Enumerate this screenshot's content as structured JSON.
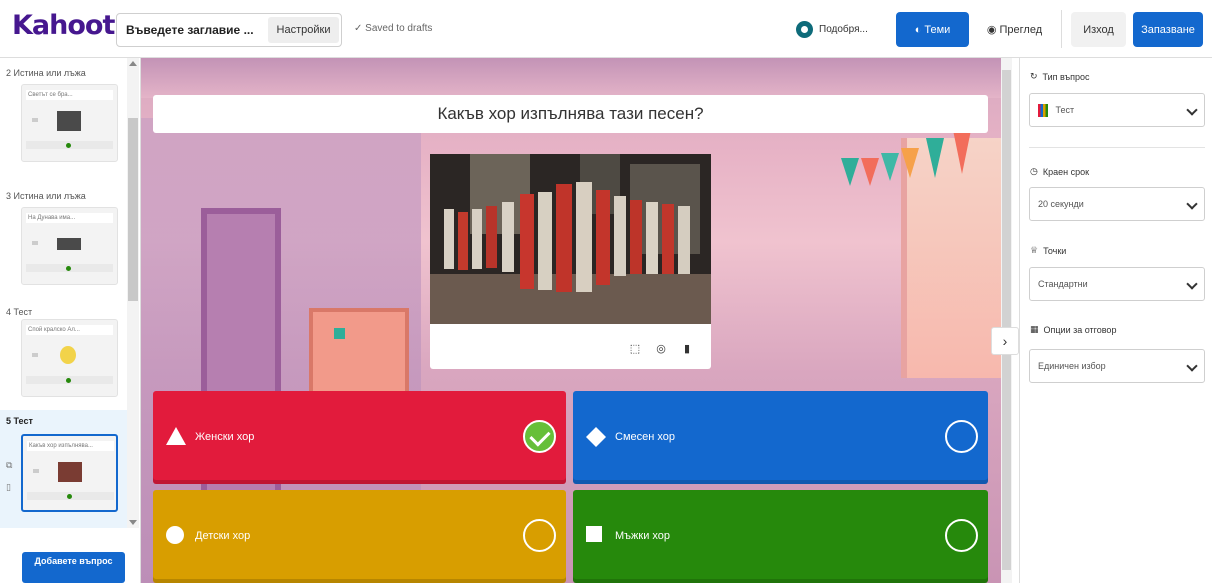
{
  "topbar": {
    "logo": "Kahoot!",
    "title_placeholder": "Въведете заглавие ...",
    "settings_label": "Настройки",
    "saved_status": "✓ Saved to drafts",
    "theme_label": "Подобря...",
    "themes_label": "Теми",
    "preview_label": "Преглед",
    "exit_label": "Изход",
    "save_label": "Запазване"
  },
  "sidebar": {
    "slides": [
      {
        "number_type": "2 Истина или лъжа",
        "question": "Светът се бра..."
      },
      {
        "number_type": "3 Истина или лъжа",
        "question": "На Дунава има..."
      },
      {
        "number_type": "4 Тест",
        "question": "Спой кралско Ал..."
      },
      {
        "number_type": "5 Тест",
        "question": "Какъв хор изпълнява..."
      }
    ],
    "add_question_label": "Добавете въпрос"
  },
  "canvas": {
    "question": "Какъв хор изпълнява тази песен?",
    "answers": [
      {
        "text": "Женски хор",
        "color": "#e21b3c",
        "shape": "triangle",
        "correct": true
      },
      {
        "text": "Смесен хор",
        "color": "#1368ce",
        "shape": "diamond",
        "correct": false
      },
      {
        "text": "Детски хор",
        "color": "#d89e00",
        "shape": "circle",
        "correct": false
      },
      {
        "text": "Мъжки хор",
        "color": "#26890c",
        "shape": "square",
        "correct": false
      }
    ]
  },
  "right_panel": {
    "question_type_label": "Тип въпрос",
    "question_type_value": "Тест",
    "time_limit_label": "Краен срок",
    "time_limit_value": "20 секунди",
    "points_label": "Точки",
    "points_value": "Стандартни",
    "answer_options_label": "Опции за отговор",
    "answer_options_value": "Единичен избор"
  },
  "colors": {
    "brand": "#46178f",
    "primary": "#1368ce",
    "red": "#e21b3c",
    "blue": "#1368ce",
    "yellow": "#d89e00",
    "green": "#26890c",
    "correct": "#66bf39"
  }
}
